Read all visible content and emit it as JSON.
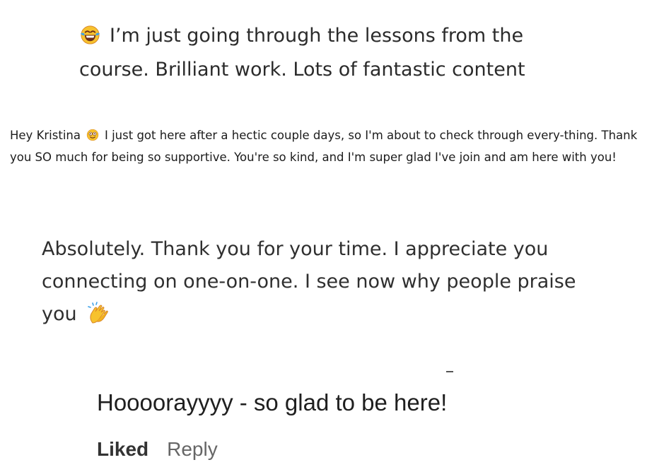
{
  "messages": [
    {
      "emoji": "laughing-face-icon",
      "text": "I’m just going through the lessons from the course. Brilliant work. Lots of fantastic content"
    },
    {
      "text_before": "Hey Kristina",
      "emoji": "dizzy-smile-icon",
      "text_after": "I just got here after a hectic couple days, so I'm about to check through every-thing. Thank you SO much for being so supportive. You're so kind, and I'm super glad I've join and am here with you!"
    },
    {
      "text": "Absolutely. Thank you for your time. I appreciate you connecting on one-on-one. I see now why people praise you",
      "emoji": "clapping-hands-icon"
    },
    {
      "text": "Hoooorayyyy - so glad to be here!"
    }
  ],
  "actions": {
    "liked_label": "Liked",
    "reply_label": "Reply"
  },
  "colors": {
    "emoji_yellow": "#F7C22D",
    "emoji_outline": "#D9882A",
    "tear_blue": "#3FA1E8",
    "mouth_dark": "#6B2E1A"
  }
}
